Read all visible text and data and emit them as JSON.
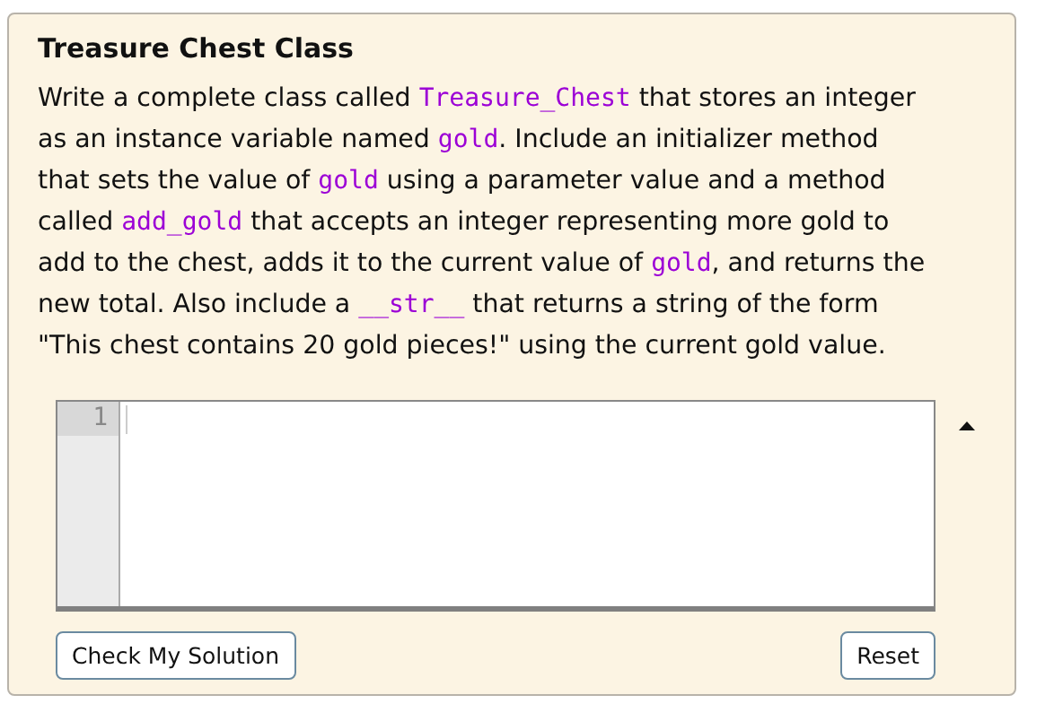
{
  "title": "Treasure Chest Class",
  "description": [
    {
      "kind": "text",
      "text": "Write a complete class called "
    },
    {
      "kind": "code",
      "text": "Treasure_Chest"
    },
    {
      "kind": "text",
      "text": " that stores an integer as an instance variable named "
    },
    {
      "kind": "code",
      "text": "gold"
    },
    {
      "kind": "text",
      "text": ". Include an initializer method that sets the value of "
    },
    {
      "kind": "code",
      "text": "gold"
    },
    {
      "kind": "text",
      "text": " using a parameter value and a method called "
    },
    {
      "kind": "code",
      "text": "add_gold"
    },
    {
      "kind": "text",
      "text": " that accepts an integer representing more gold to add to the chest, adds it to the current value of "
    },
    {
      "kind": "code",
      "text": "gold"
    },
    {
      "kind": "text",
      "text": ", and returns the new total. Also include a "
    },
    {
      "kind": "code",
      "text": "__str__"
    },
    {
      "kind": "text",
      "text": " that returns a string of the form \"This chest contains 20 gold pieces!\" using the current gold value."
    }
  ],
  "editor": {
    "line_numbers": [
      "1"
    ]
  },
  "buttons": [
    "Check My Solution",
    "Reset"
  ]
}
